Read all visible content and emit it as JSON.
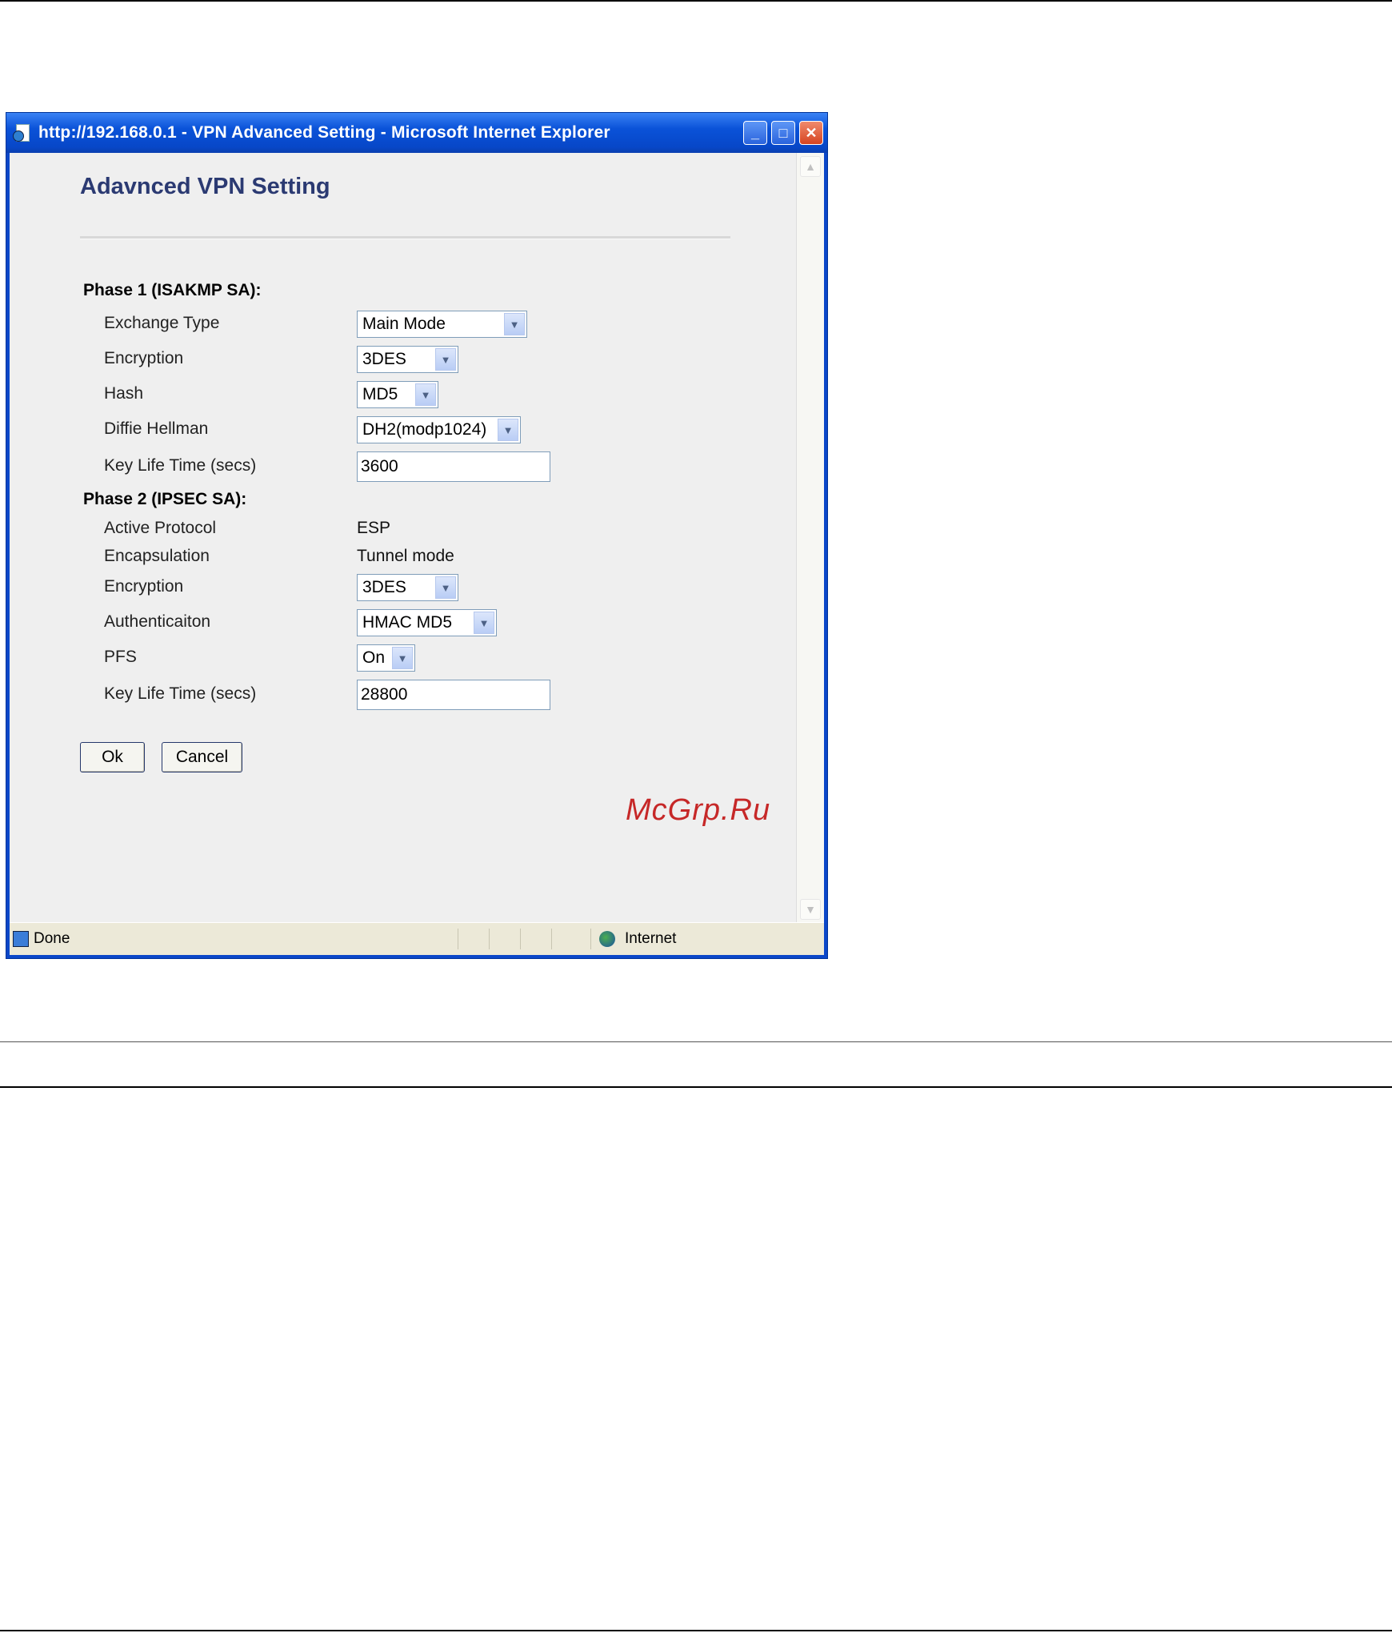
{
  "window": {
    "title": "http://192.168.0.1 - VPN Advanced Setting - Microsoft Internet Explorer",
    "minimize_icon": "minimize-icon",
    "maximize_icon": "maximize-icon",
    "close_icon": "close-icon"
  },
  "page": {
    "title": "Adavnced VPN Setting"
  },
  "phase1": {
    "heading": "Phase 1 (ISAKMP SA):",
    "exchange_type": {
      "label": "Exchange Type",
      "value": "Main Mode"
    },
    "encryption": {
      "label": "Encryption",
      "value": "3DES"
    },
    "hash": {
      "label": "Hash",
      "value": "MD5"
    },
    "diffie_hellman": {
      "label": "Diffie Hellman",
      "value": "DH2(modp1024)"
    },
    "key_life": {
      "label": "Key Life Time (secs)",
      "value": "3600"
    }
  },
  "phase2": {
    "heading": "Phase 2 (IPSEC SA):",
    "active_protocol": {
      "label": "Active Protocol",
      "value": "ESP"
    },
    "encapsulation": {
      "label": "Encapsulation",
      "value": "Tunnel mode"
    },
    "encryption": {
      "label": "Encryption",
      "value": "3DES"
    },
    "authentication": {
      "label": "Authenticaiton",
      "value": "HMAC MD5"
    },
    "pfs": {
      "label": "PFS",
      "value": "On"
    },
    "key_life": {
      "label": "Key Life Time (secs)",
      "value": "28800"
    }
  },
  "buttons": {
    "ok": "Ok",
    "cancel": "Cancel"
  },
  "statusbar": {
    "status": "Done",
    "zone": "Internet"
  },
  "watermark": "McGrp.Ru"
}
